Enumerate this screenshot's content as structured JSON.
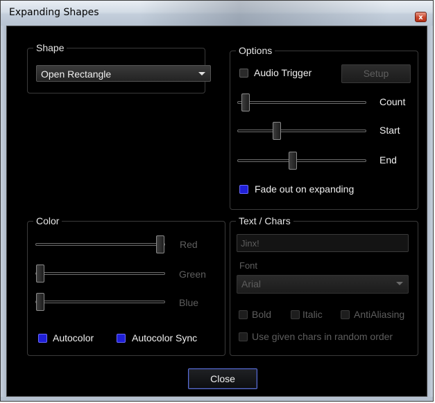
{
  "window": {
    "title": "Expanding Shapes",
    "close_glyph": "x"
  },
  "shape": {
    "group_label": "Shape",
    "selected": "Open Rectangle"
  },
  "options": {
    "group_label": "Options",
    "audio_trigger": {
      "label": "Audio Trigger",
      "checked": false
    },
    "setup_button": "Setup",
    "sliders": [
      {
        "label": "Count",
        "value": 0.03
      },
      {
        "label": "Start",
        "value": 0.32
      },
      {
        "label": "End",
        "value": 0.44
      }
    ],
    "fade_out": {
      "label": "Fade out on expanding",
      "checked": true
    }
  },
  "color": {
    "group_label": "Color",
    "sliders": [
      {
        "label": "Red",
        "value": 1.0
      },
      {
        "label": "Green",
        "value": 0.0
      },
      {
        "label": "Blue",
        "value": 0.0
      }
    ],
    "autocolor": {
      "label": "Autocolor",
      "checked": true
    },
    "autocolor_sync": {
      "label": "Autocolor Sync",
      "checked": true
    }
  },
  "text_chars": {
    "group_label": "Text / Chars",
    "text_value": "Jinx!",
    "font_label": "Font",
    "font_selected": "Arial",
    "bold": {
      "label": "Bold",
      "checked": false
    },
    "italic": {
      "label": "Italic",
      "checked": false
    },
    "antialiasing": {
      "label": "AntiAliasing",
      "checked": false
    },
    "random_order": {
      "label": "Use given chars in random order",
      "checked": false
    }
  },
  "footer": {
    "close_button": "Close"
  },
  "colors": {
    "checked_blue": "#1f1fd6",
    "dialog_bg": "#000000",
    "disabled_text": "#5e5e5e",
    "close_button_border": "#5a6fd8"
  }
}
